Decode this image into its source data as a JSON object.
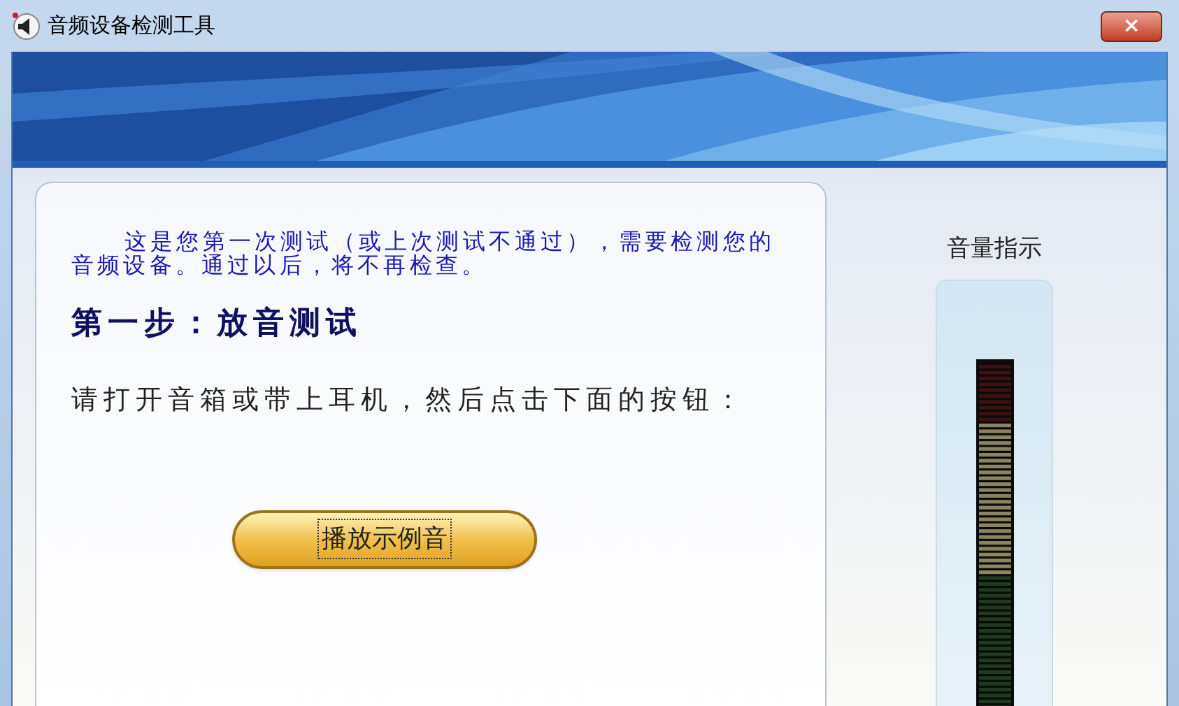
{
  "window": {
    "title": "音频设备检测工具",
    "close": "×"
  },
  "intro": "这是您第一次测试（或上次测试不通过），需要检测您的音频设备。通过以后，将不再检查。",
  "step_title": "第一步：放音测试",
  "instruction": "请打开音箱或带上耳机，然后点击下面的按钮：",
  "play_button": {
    "label": "播放示例音",
    "focused": true
  },
  "meter": {
    "label": "音量指示"
  }
}
